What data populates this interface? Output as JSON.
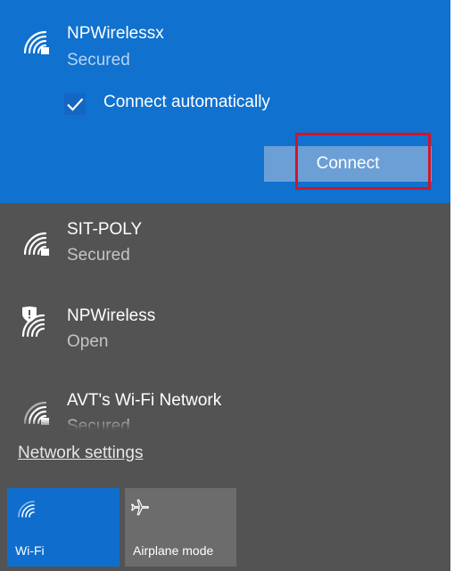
{
  "selected_network": {
    "name": "NPWirelessx",
    "status": "Secured",
    "connect_automatically_label": "Connect automatically",
    "connect_automatically_checked": true,
    "connect_button_label": "Connect",
    "icon": "wifi-secured-icon"
  },
  "networks": [
    {
      "name": "SIT-POLY",
      "status": "Secured",
      "icon": "wifi-secured-icon"
    },
    {
      "name": "NPWireless",
      "status": "Open",
      "icon": "wifi-open-shield-icon"
    },
    {
      "name": "AVT's Wi-Fi Network",
      "status": "Secured",
      "icon": "wifi-secured-icon"
    }
  ],
  "network_settings_label": "Network settings",
  "quick_actions": [
    {
      "label": "Wi-Fi",
      "icon": "wifi-icon",
      "active": true
    },
    {
      "label": "Airplane mode",
      "icon": "airplane-icon",
      "active": false
    }
  ],
  "colors": {
    "accent": "#1071cf",
    "panel": "#535353",
    "highlight": "#d3142a",
    "tile_inactive": "#6c6c6c"
  }
}
